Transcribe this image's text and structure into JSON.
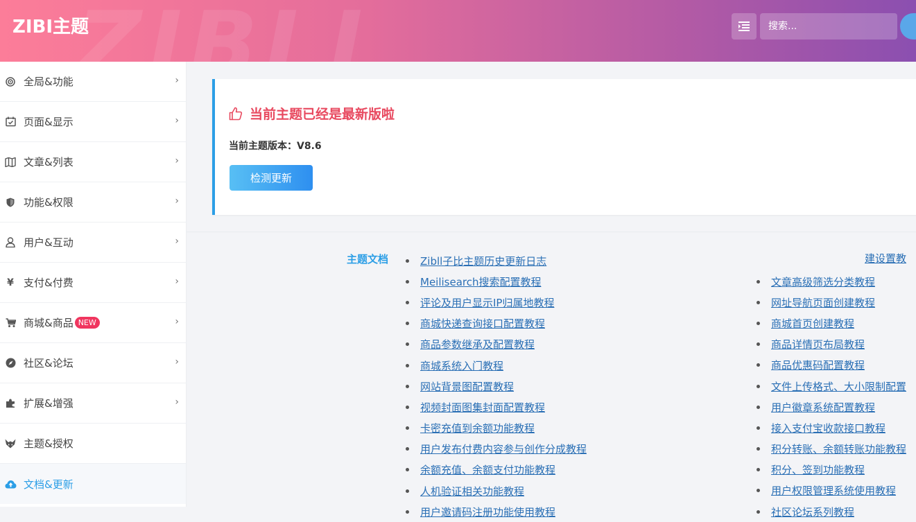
{
  "header": {
    "logo": "ZIBI主题",
    "watermark": "ZIBLL",
    "search_placeholder": "搜索..."
  },
  "sidebar": {
    "items": [
      {
        "label": "全局&功能",
        "icon": "target-icon"
      },
      {
        "label": "页面&显示",
        "icon": "calendar-check-icon"
      },
      {
        "label": "文章&列表",
        "icon": "map-icon"
      },
      {
        "label": "功能&权限",
        "icon": "shield-icon"
      },
      {
        "label": "用户&互动",
        "icon": "user-icon"
      },
      {
        "label": "支付&付费",
        "icon": "yen-icon"
      },
      {
        "label": "商城&商品",
        "icon": "cart-icon",
        "badge": "NEW"
      },
      {
        "label": "社区&论坛",
        "icon": "compass-icon"
      },
      {
        "label": "扩展&增强",
        "icon": "puzzle-icon"
      },
      {
        "label": "主题&授权",
        "icon": "fox-icon"
      },
      {
        "label": "文档&更新",
        "icon": "cloud-upload-icon",
        "active": true
      }
    ]
  },
  "update": {
    "title": "当前主题已经是最新版啦",
    "version_label": "当前主题版本：",
    "version": "V8.6",
    "check_button": "检测更新"
  },
  "docs": {
    "label": "主题文档",
    "col1": [
      "Zibll子比主题历史更新日志",
      "Meilisearch搜索配置教程",
      "评论及用户显示IP归属地教程",
      "商城快递查询接口配置教程",
      "商品参数继承及配置教程",
      "商城系统入门教程",
      "网站背景图配置教程",
      "视频封面图集封面配置教程",
      "卡密充值到余额功能教程",
      "用户发布付费内容参与创作分成教程",
      "余额充值、余额支付功能教程",
      "人机验证相关功能教程",
      "用户邀请码注册功能使用教程"
    ],
    "col2_partial_top": "建设置教",
    "col2": [
      "文章高级筛选分类教程",
      "网址导航页面创建教程",
      "商城首页创建教程",
      "商品详情页布局教程",
      "商品优惠码配置教程",
      "文件上传格式、大小限制配置",
      "用户徽章系统配置教程",
      "接入支付宝收款接口教程",
      "积分转账、余额转账功能教程",
      "积分、签到功能教程",
      "用户权限管理系统使用教程",
      "社区论坛系列教程"
    ]
  },
  "colors": {
    "accent": "#2b9ee6",
    "title_red": "#e8495f",
    "badge": "#f0365f",
    "link": "#2a6fb5"
  }
}
